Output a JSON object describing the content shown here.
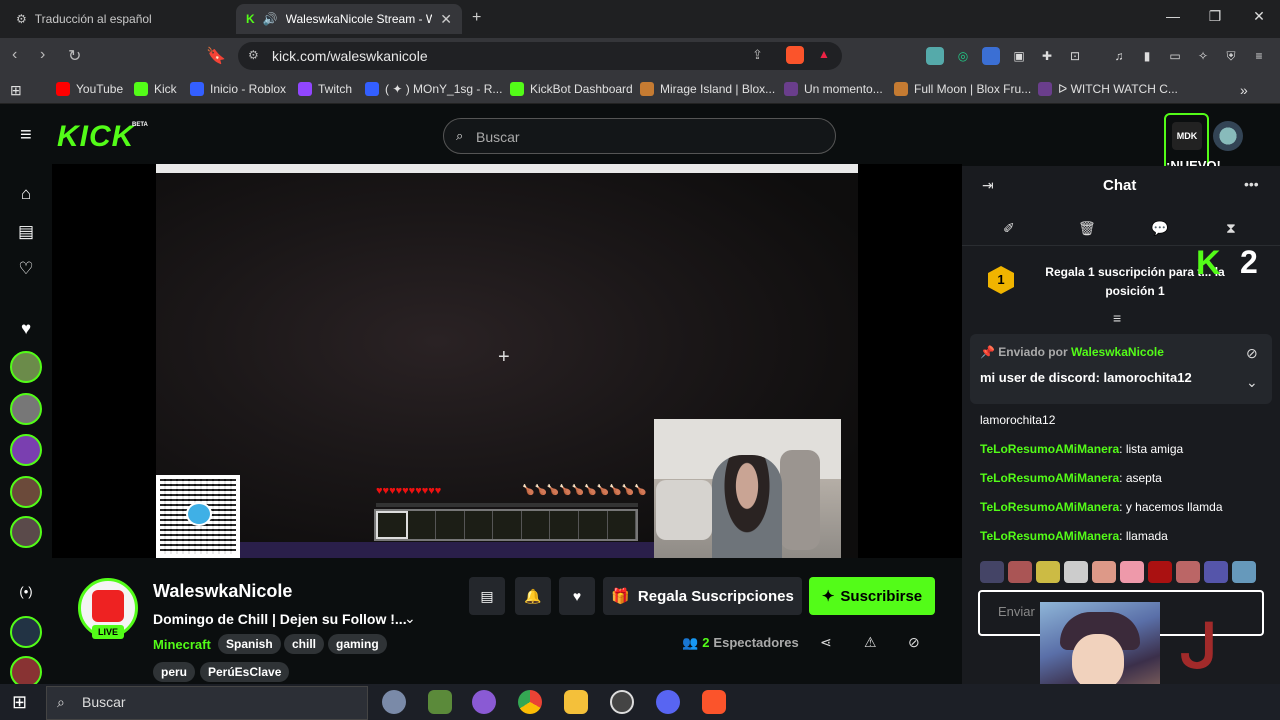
{
  "browser": {
    "tabs": [
      {
        "title": "Traducción al español",
        "active": false
      },
      {
        "title": "WaleswkaNicole Stream - Wa",
        "active": true
      }
    ],
    "url": "kick.com/waleswkanicole",
    "bookmarks": [
      {
        "label": "YouTube",
        "color": "#ff0000"
      },
      {
        "label": "Kick",
        "color": "#53fc18"
      },
      {
        "label": "Inicio - Roblox",
        "color": "#335fff"
      },
      {
        "label": "Twitch",
        "color": "#9146ff"
      },
      {
        "label": "( ✦ ) MOnY_1sg - R...",
        "color": "#335fff"
      },
      {
        "label": "KickBot Dashboard",
        "color": "#53fc18"
      },
      {
        "label": "Mirage Island | Blox...",
        "color": "#c57b32"
      },
      {
        "label": "Un momento...",
        "color": "#6a3e8c"
      },
      {
        "label": "Full Moon | Blox Fru...",
        "color": "#c57b32"
      },
      {
        "label": "ᐅ WITCH WATCH C...",
        "color": "#6a3e8c"
      }
    ]
  },
  "kick": {
    "logo": "KICK",
    "beta": "BETA",
    "search_placeholder": "Buscar",
    "new_badge": "¡NUEVO!",
    "accent": "#53fc18"
  },
  "stream": {
    "streamer": "WaleswkaNicole",
    "live_label": "LIVE",
    "title": "Domingo de Chill | Dejen su Follow !...",
    "category": "Minecraft",
    "tags": [
      "Spanish",
      "chill",
      "gaming",
      "peru",
      "PerúEsClave"
    ],
    "gift_button": "Regala Suscripciones",
    "subscribe_button": "Suscribirse",
    "viewer_count": "2",
    "viewers_label": "Espectadores"
  },
  "game_overlay": {
    "health_hearts": 10,
    "hunger": 10,
    "hotbar_slots": 9
  },
  "chat": {
    "title": "Chat",
    "gift_rank": "1",
    "gift_message": "Regala 1 suscripción para t... la posición 1",
    "k_count": "2",
    "pinned_by_label": "Enviado por",
    "pinned_user": "WaleswkaNicole",
    "pinned_message": "mi user de discord: lamorochita12",
    "messages": [
      {
        "user": "",
        "text": "lamorochita12"
      },
      {
        "user": "TeLoResumoAMiManera",
        "text": "lista amiga"
      },
      {
        "user": "TeLoResumoAMiManera",
        "text": "asepta"
      },
      {
        "user": "TeLoResumoAMiManera",
        "text": "y hacemos llamda"
      },
      {
        "user": "TeLoResumoAMiManera",
        "text": "llamada"
      }
    ],
    "input_placeholder": "Enviar"
  },
  "taskbar": {
    "search_placeholder": "Buscar"
  }
}
